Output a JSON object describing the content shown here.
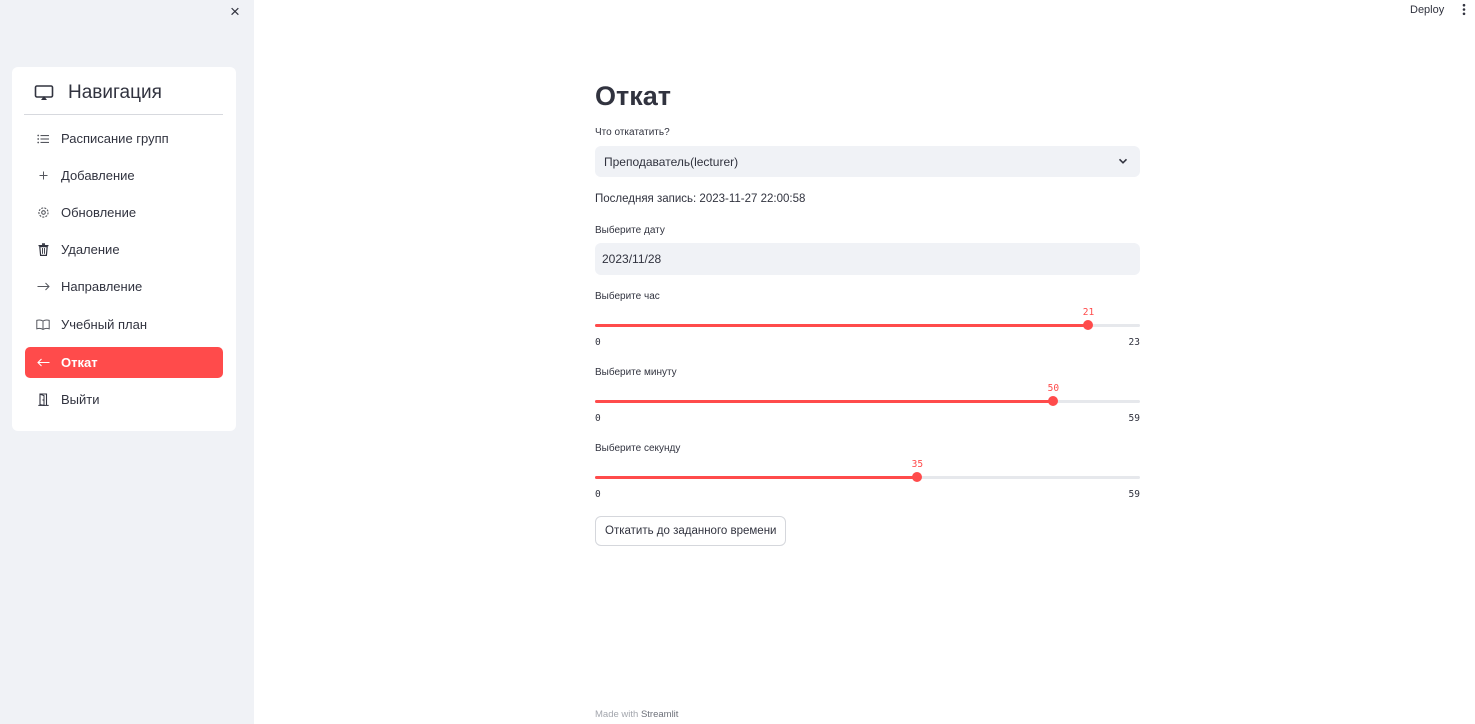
{
  "sidebar": {
    "close_label": "×",
    "nav_title": "Навигация",
    "items": [
      {
        "label": "Расписание групп",
        "icon": "list-icon"
      },
      {
        "label": "Добавление",
        "icon": "plus-icon"
      },
      {
        "label": "Обновление",
        "icon": "gear-icon"
      },
      {
        "label": "Удаление",
        "icon": "trash-icon"
      },
      {
        "label": "Направление",
        "icon": "arrow-right-icon"
      },
      {
        "label": "Учебный план",
        "icon": "book-icon"
      },
      {
        "label": "Откат",
        "icon": "arrow-left-icon",
        "active": true
      },
      {
        "label": "Выйти",
        "icon": "door-icon"
      }
    ]
  },
  "header": {
    "deploy_label": "Deploy"
  },
  "main": {
    "title": "Откат",
    "rollback_target": {
      "label": "Что откататить?",
      "value": "Преподаватель(lecturer)"
    },
    "last_record": "Последняя запись: 2023-11-27 22:00:58",
    "date": {
      "label": "Выберите дату",
      "value": "2023/11/28"
    },
    "hour": {
      "label": "Выберите час",
      "value": 21,
      "min": 0,
      "max": 23
    },
    "minute": {
      "label": "Выберите минуту",
      "value": 50,
      "min": 0,
      "max": 59
    },
    "second": {
      "label": "Выберите секунду",
      "value": 35,
      "min": 0,
      "max": 59
    },
    "submit_label": "Откатить до заданного времени"
  },
  "footer": {
    "made_with": "Made with",
    "brand": "Streamlit"
  },
  "colors": {
    "accent": "#ff4b4b",
    "sidebar_bg": "#f0f2f6",
    "text": "#31333f"
  }
}
